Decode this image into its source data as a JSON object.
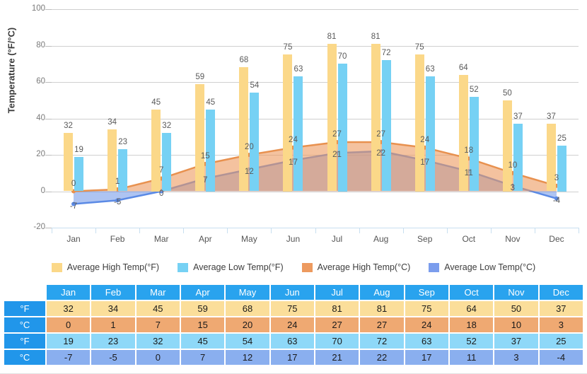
{
  "chart_data": {
    "type": "bar",
    "title": "",
    "xlabel": "",
    "ylabel": "Temperature (°F/°C)",
    "ylim": [
      -20,
      100
    ],
    "yticks": [
      100,
      80,
      60,
      40,
      20,
      0,
      -20
    ],
    "grid": true,
    "legend_position": "bottom",
    "categories": [
      "Jan",
      "Feb",
      "Mar",
      "Apr",
      "May",
      "Jun",
      "Jul",
      "Aug",
      "Sep",
      "Oct",
      "Nov",
      "Dec"
    ],
    "series": [
      {
        "name": "Average High Temp(°F)",
        "type": "bar",
        "color": "#fbd889",
        "values": [
          32,
          34,
          45,
          59,
          68,
          75,
          81,
          81,
          75,
          64,
          50,
          37
        ]
      },
      {
        "name": "Average Low Temp(°F)",
        "type": "bar",
        "color": "#76d1f4",
        "values": [
          19,
          23,
          32,
          45,
          54,
          63,
          70,
          72,
          63,
          52,
          37,
          25
        ]
      },
      {
        "name": "Average High Temp(°C)",
        "type": "area",
        "color": "#ed9a5f",
        "values": [
          0,
          1,
          7,
          15,
          20,
          24,
          27,
          27,
          24,
          18,
          10,
          3
        ]
      },
      {
        "name": "Average Low Temp(°C)",
        "type": "area",
        "color": "#6c93e8",
        "values": [
          -7,
          -5,
          0,
          7,
          12,
          17,
          21,
          22,
          17,
          11,
          3,
          -4
        ]
      }
    ]
  },
  "legend": {
    "items": [
      {
        "label": "Average High Temp(°F)",
        "color": "#fbd889"
      },
      {
        "label": "Average Low Temp(°F)",
        "color": "#76d1f4"
      },
      {
        "label": "Average High Temp(°C)",
        "color": "#ed9a5f"
      },
      {
        "label": "Average Low Temp(°C)",
        "color": "#7b9ded"
      }
    ]
  },
  "table": {
    "corner": "",
    "months": [
      "Jan",
      "Feb",
      "Mar",
      "Apr",
      "May",
      "Jun",
      "Jul",
      "Aug",
      "Sep",
      "Oct",
      "Nov",
      "Dec"
    ],
    "rows": [
      {
        "label": "°F",
        "style": "v-fh",
        "values": [
          "32",
          "34",
          "45",
          "59",
          "68",
          "75",
          "81",
          "81",
          "75",
          "64",
          "50",
          "37"
        ]
      },
      {
        "label": "°C",
        "style": "v-ch",
        "values": [
          "0",
          "1",
          "7",
          "15",
          "20",
          "24",
          "27",
          "27",
          "24",
          "18",
          "10",
          "3"
        ]
      },
      {
        "label": "°F",
        "style": "v-fl",
        "values": [
          "19",
          "23",
          "32",
          "45",
          "54",
          "63",
          "70",
          "72",
          "63",
          "52",
          "37",
          "25"
        ]
      },
      {
        "label": "°C",
        "style": "v-cl",
        "values": [
          "-7",
          "-5",
          "0",
          "7",
          "12",
          "17",
          "21",
          "22",
          "17",
          "11",
          "3",
          "-4"
        ]
      }
    ]
  }
}
